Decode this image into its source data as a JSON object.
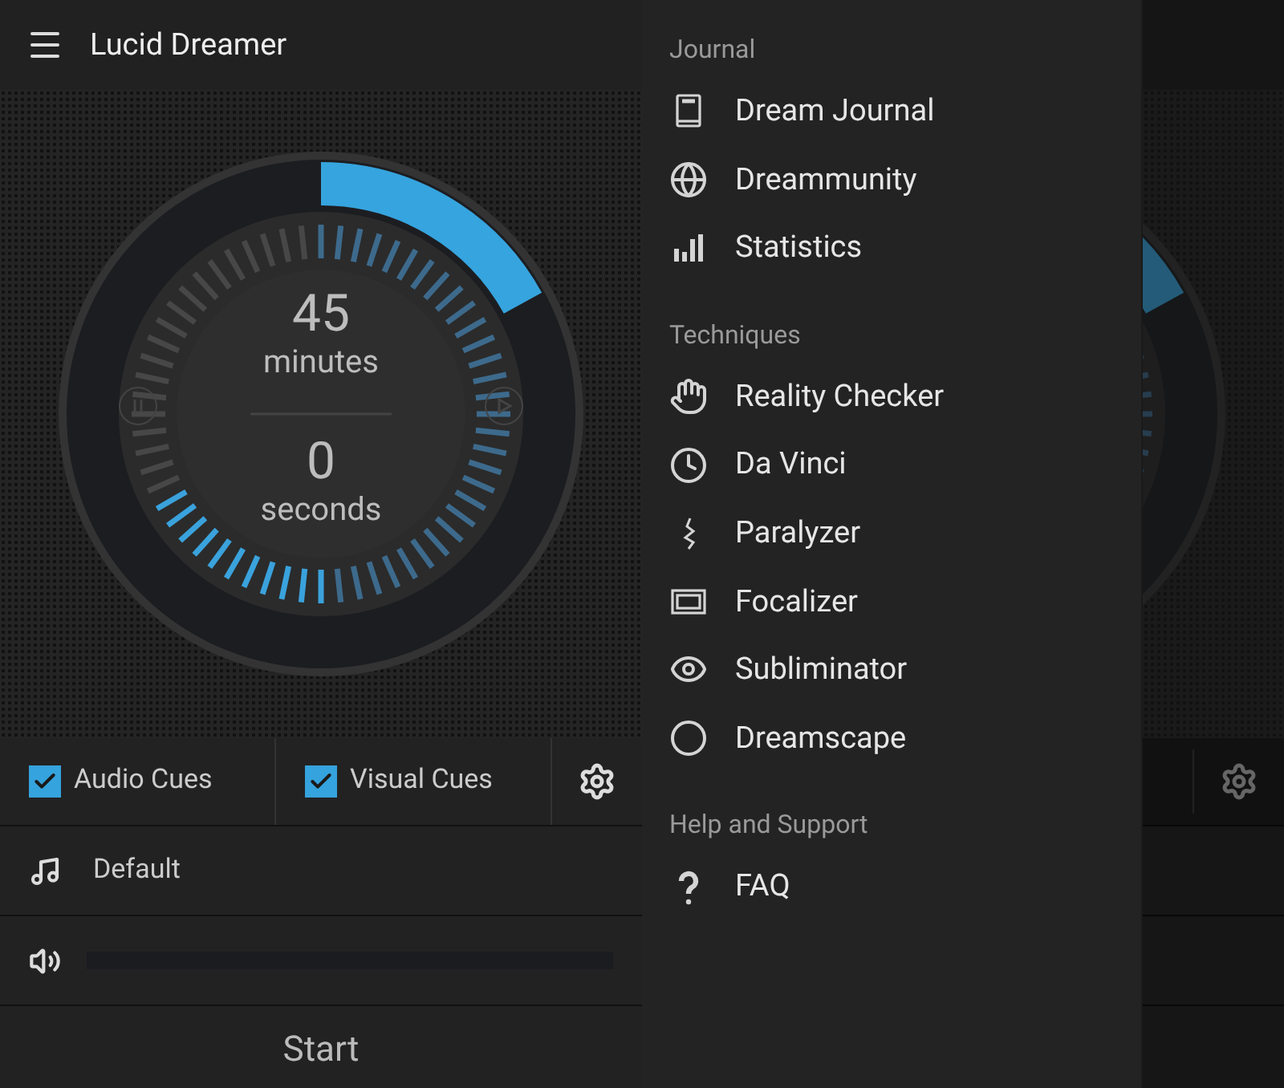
{
  "app_bar": {
    "title": "Lucid Dreamer"
  },
  "timer": {
    "minutes": "45",
    "minutes_label": "minutes",
    "seconds": "0",
    "seconds_label": "seconds"
  },
  "cues": [
    {
      "label": "Audio Cues",
      "checked": true
    },
    {
      "label": "Visual Cues",
      "checked": true
    }
  ],
  "sound": {
    "name": "Default"
  },
  "volume": {
    "level": 0
  },
  "start_button": "Start",
  "drawer": {
    "sections": [
      {
        "title": "Journal",
        "items": [
          "Dream Journal",
          "Dreammunity",
          "Statistics"
        ]
      },
      {
        "title": "Techniques",
        "items": [
          "Reality Checker",
          "Da Vinci",
          "Paralyzer",
          "Focalizer",
          "Subliminator",
          "Dreamscape"
        ]
      },
      {
        "title": "Help and Support",
        "items": [
          "FAQ"
        ]
      }
    ]
  }
}
